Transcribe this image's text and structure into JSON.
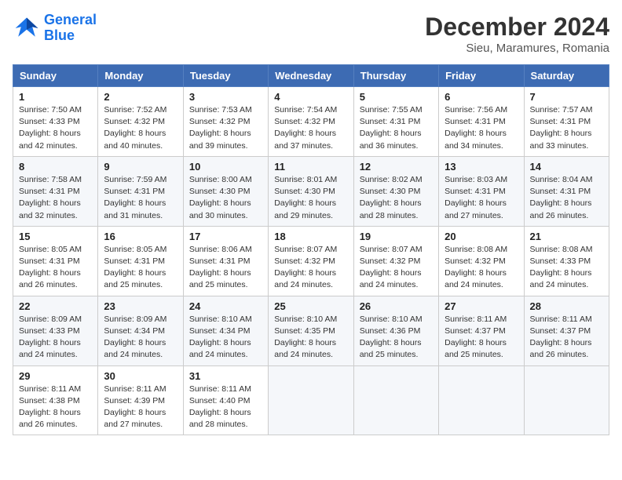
{
  "header": {
    "logo_line1": "General",
    "logo_line2": "Blue",
    "title": "December 2024",
    "subtitle": "Sieu, Maramures, Romania"
  },
  "weekdays": [
    "Sunday",
    "Monday",
    "Tuesday",
    "Wednesday",
    "Thursday",
    "Friday",
    "Saturday"
  ],
  "weeks": [
    [
      {
        "day": "1",
        "lines": [
          "Sunrise: 7:50 AM",
          "Sunset: 4:33 PM",
          "Daylight: 8 hours",
          "and 42 minutes."
        ]
      },
      {
        "day": "2",
        "lines": [
          "Sunrise: 7:52 AM",
          "Sunset: 4:32 PM",
          "Daylight: 8 hours",
          "and 40 minutes."
        ]
      },
      {
        "day": "3",
        "lines": [
          "Sunrise: 7:53 AM",
          "Sunset: 4:32 PM",
          "Daylight: 8 hours",
          "and 39 minutes."
        ]
      },
      {
        "day": "4",
        "lines": [
          "Sunrise: 7:54 AM",
          "Sunset: 4:32 PM",
          "Daylight: 8 hours",
          "and 37 minutes."
        ]
      },
      {
        "day": "5",
        "lines": [
          "Sunrise: 7:55 AM",
          "Sunset: 4:31 PM",
          "Daylight: 8 hours",
          "and 36 minutes."
        ]
      },
      {
        "day": "6",
        "lines": [
          "Sunrise: 7:56 AM",
          "Sunset: 4:31 PM",
          "Daylight: 8 hours",
          "and 34 minutes."
        ]
      },
      {
        "day": "7",
        "lines": [
          "Sunrise: 7:57 AM",
          "Sunset: 4:31 PM",
          "Daylight: 8 hours",
          "and 33 minutes."
        ]
      }
    ],
    [
      {
        "day": "8",
        "lines": [
          "Sunrise: 7:58 AM",
          "Sunset: 4:31 PM",
          "Daylight: 8 hours",
          "and 32 minutes."
        ]
      },
      {
        "day": "9",
        "lines": [
          "Sunrise: 7:59 AM",
          "Sunset: 4:31 PM",
          "Daylight: 8 hours",
          "and 31 minutes."
        ]
      },
      {
        "day": "10",
        "lines": [
          "Sunrise: 8:00 AM",
          "Sunset: 4:30 PM",
          "Daylight: 8 hours",
          "and 30 minutes."
        ]
      },
      {
        "day": "11",
        "lines": [
          "Sunrise: 8:01 AM",
          "Sunset: 4:30 PM",
          "Daylight: 8 hours",
          "and 29 minutes."
        ]
      },
      {
        "day": "12",
        "lines": [
          "Sunrise: 8:02 AM",
          "Sunset: 4:30 PM",
          "Daylight: 8 hours",
          "and 28 minutes."
        ]
      },
      {
        "day": "13",
        "lines": [
          "Sunrise: 8:03 AM",
          "Sunset: 4:31 PM",
          "Daylight: 8 hours",
          "and 27 minutes."
        ]
      },
      {
        "day": "14",
        "lines": [
          "Sunrise: 8:04 AM",
          "Sunset: 4:31 PM",
          "Daylight: 8 hours",
          "and 26 minutes."
        ]
      }
    ],
    [
      {
        "day": "15",
        "lines": [
          "Sunrise: 8:05 AM",
          "Sunset: 4:31 PM",
          "Daylight: 8 hours",
          "and 26 minutes."
        ]
      },
      {
        "day": "16",
        "lines": [
          "Sunrise: 8:05 AM",
          "Sunset: 4:31 PM",
          "Daylight: 8 hours",
          "and 25 minutes."
        ]
      },
      {
        "day": "17",
        "lines": [
          "Sunrise: 8:06 AM",
          "Sunset: 4:31 PM",
          "Daylight: 8 hours",
          "and 25 minutes."
        ]
      },
      {
        "day": "18",
        "lines": [
          "Sunrise: 8:07 AM",
          "Sunset: 4:32 PM",
          "Daylight: 8 hours",
          "and 24 minutes."
        ]
      },
      {
        "day": "19",
        "lines": [
          "Sunrise: 8:07 AM",
          "Sunset: 4:32 PM",
          "Daylight: 8 hours",
          "and 24 minutes."
        ]
      },
      {
        "day": "20",
        "lines": [
          "Sunrise: 8:08 AM",
          "Sunset: 4:32 PM",
          "Daylight: 8 hours",
          "and 24 minutes."
        ]
      },
      {
        "day": "21",
        "lines": [
          "Sunrise: 8:08 AM",
          "Sunset: 4:33 PM",
          "Daylight: 8 hours",
          "and 24 minutes."
        ]
      }
    ],
    [
      {
        "day": "22",
        "lines": [
          "Sunrise: 8:09 AM",
          "Sunset: 4:33 PM",
          "Daylight: 8 hours",
          "and 24 minutes."
        ]
      },
      {
        "day": "23",
        "lines": [
          "Sunrise: 8:09 AM",
          "Sunset: 4:34 PM",
          "Daylight: 8 hours",
          "and 24 minutes."
        ]
      },
      {
        "day": "24",
        "lines": [
          "Sunrise: 8:10 AM",
          "Sunset: 4:34 PM",
          "Daylight: 8 hours",
          "and 24 minutes."
        ]
      },
      {
        "day": "25",
        "lines": [
          "Sunrise: 8:10 AM",
          "Sunset: 4:35 PM",
          "Daylight: 8 hours",
          "and 24 minutes."
        ]
      },
      {
        "day": "26",
        "lines": [
          "Sunrise: 8:10 AM",
          "Sunset: 4:36 PM",
          "Daylight: 8 hours",
          "and 25 minutes."
        ]
      },
      {
        "day": "27",
        "lines": [
          "Sunrise: 8:11 AM",
          "Sunset: 4:37 PM",
          "Daylight: 8 hours",
          "and 25 minutes."
        ]
      },
      {
        "day": "28",
        "lines": [
          "Sunrise: 8:11 AM",
          "Sunset: 4:37 PM",
          "Daylight: 8 hours",
          "and 26 minutes."
        ]
      }
    ],
    [
      {
        "day": "29",
        "lines": [
          "Sunrise: 8:11 AM",
          "Sunset: 4:38 PM",
          "Daylight: 8 hours",
          "and 26 minutes."
        ]
      },
      {
        "day": "30",
        "lines": [
          "Sunrise: 8:11 AM",
          "Sunset: 4:39 PM",
          "Daylight: 8 hours",
          "and 27 minutes."
        ]
      },
      {
        "day": "31",
        "lines": [
          "Sunrise: 8:11 AM",
          "Sunset: 4:40 PM",
          "Daylight: 8 hours",
          "and 28 minutes."
        ]
      },
      null,
      null,
      null,
      null
    ]
  ]
}
